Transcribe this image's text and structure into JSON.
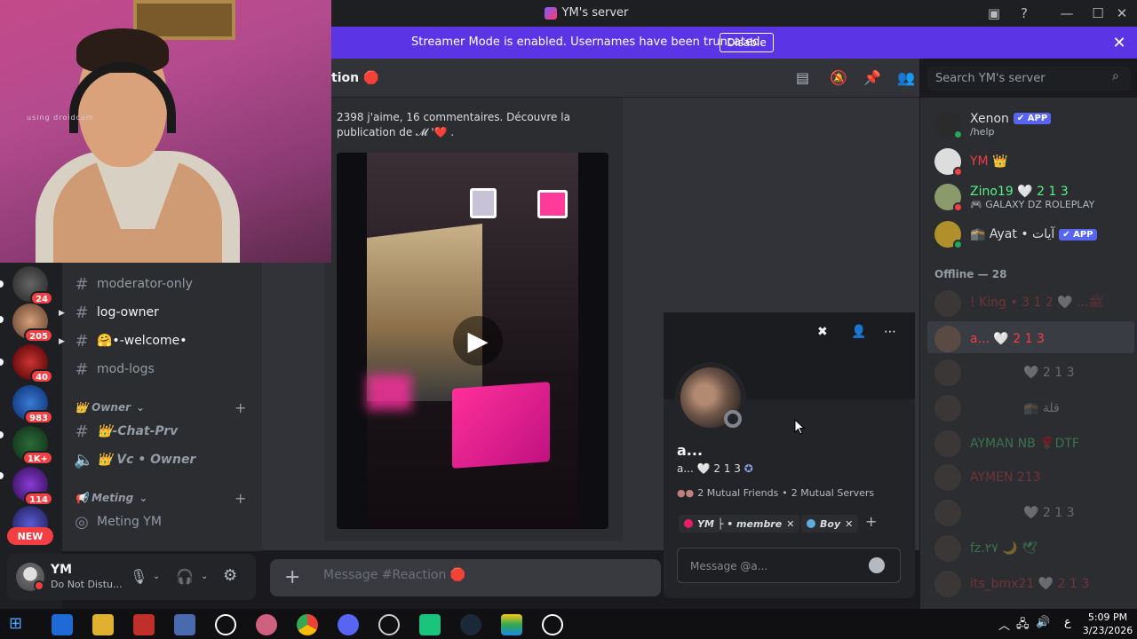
{
  "window": {
    "title": "YM's server"
  },
  "banner": {
    "text": "Streamer Mode is enabled. Usernames have been truncated.",
    "button": "Disable"
  },
  "webcam": {
    "watermark": "using droidcam"
  },
  "rail": {
    "servers": [
      {
        "badge": "24"
      },
      {
        "badge": "205"
      },
      {
        "badge": "40"
      },
      {
        "badge": "983"
      },
      {
        "badge": "1K+"
      },
      {
        "badge": "114"
      }
    ],
    "new_label": "NEW"
  },
  "channels": {
    "items": [
      {
        "name": "moderator-only"
      },
      {
        "name": "log-owner"
      },
      {
        "name": "🤗•-welcome•"
      },
      {
        "name": "mod-logs"
      }
    ],
    "cat_owner": "👑 Owner",
    "owner_items": [
      {
        "name": "👑-Chat-Prv"
      },
      {
        "name": "👑 Vc • Owner"
      }
    ],
    "cat_meting": "📢 Meting",
    "meting_items": [
      {
        "name": "Meting YM"
      }
    ]
  },
  "user": {
    "name": "YM",
    "status": "Do Not Distu..."
  },
  "header": {
    "channel": "tion 🛑",
    "search_placeholder": "Search YM's server"
  },
  "embed": {
    "text": "2398 j'aime, 16 commentaires. Découvre la publication de 𝓜 '❤️ ."
  },
  "composer": {
    "placeholder": "Message #Reaction 🛑"
  },
  "popout": {
    "name": "a...",
    "tag": "a... 🤍 2 1 3",
    "mutual_friends": "2 Mutual Friends",
    "mutual_servers": "2 Mutual Servers",
    "roles": [
      {
        "label": "YM ├ • membre",
        "color": "#e91e63"
      },
      {
        "label": "Boy",
        "color": "#5dade2"
      }
    ],
    "message_placeholder": "Message @a..."
  },
  "members": {
    "online": [
      {
        "name": "Xenon",
        "sub": "/help",
        "tag": "✔ APP",
        "color": "#dbdee1"
      },
      {
        "name": "YM 👑",
        "sub": "",
        "tag": "",
        "color": "#f23f43"
      },
      {
        "name": "Zino19 🤍 2 1 3",
        "sub": "🎮 GALAXY DZ ROLEPLAY",
        "tag": "",
        "color": "#57f287"
      },
      {
        "name": "🕋 Ayat • آيات",
        "sub": "",
        "tag": "✔ APP",
        "color": "#dbdee1"
      }
    ],
    "offline_header": "Offline — 28",
    "offline": [
      {
        "name": "! King • ﷺ... 🤍 2 1 3",
        "color": "#f23f43"
      },
      {
        "name": "a... 🤍 2 1 3",
        "color": "#f23f43"
      },
      {
        "name": "🤍 2 1 3",
        "color": "#dbdee1"
      },
      {
        "name": "🕋 قلة",
        "color": "#dbdee1"
      },
      {
        "name": "AYMAN NB 🌹DTF",
        "color": "#57f287"
      },
      {
        "name": "AYMEN 213",
        "color": "#f23f43"
      },
      {
        "name": "🤍 2 1 3",
        "color": "#dbdee1"
      },
      {
        "name": "fz.٢٧ 🌙 🕊",
        "color": "#57f287"
      },
      {
        "name": "its_bmx21 🤍 2 1 3",
        "color": "#f23f43"
      }
    ]
  },
  "taskbar": {
    "time": "5:09 PM",
    "date": "3/23/2026",
    "lang": "ع"
  }
}
